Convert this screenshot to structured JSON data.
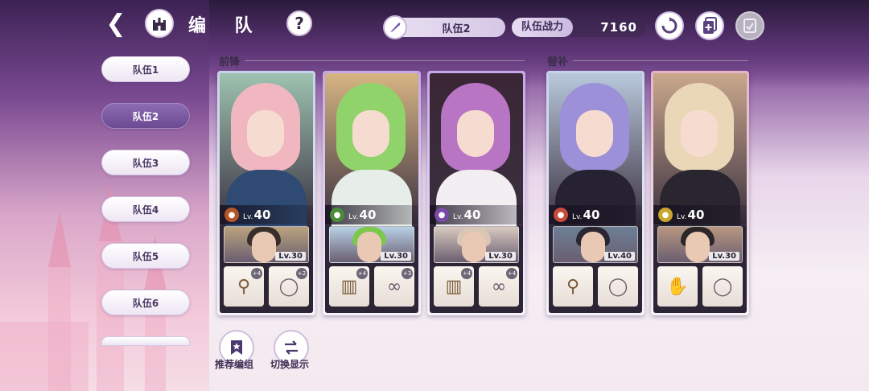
{
  "header": {
    "title": "编 队",
    "current_team": "队伍2",
    "power_label": "队伍战力",
    "power_value": "7160"
  },
  "team_tabs": [
    "队伍1",
    "队伍2",
    "队伍3",
    "队伍4",
    "队伍5",
    "队伍6"
  ],
  "active_team_index": 1,
  "sections": {
    "front": "前锋",
    "sub": "替补"
  },
  "cards": [
    {
      "lv_prefix": "Lv.",
      "level": "40",
      "sub_level": "Lv.30",
      "element_color": "#b5552a",
      "hair_color": "#f0b7c1",
      "outfit_color": "#2f4b73",
      "bg_color": "#9dc3b0",
      "frame_color": "#c7d2ea",
      "sub_hair": "#3a2e2a",
      "sub_bg": "#b9a37e",
      "equip1": {
        "icon": "staff-icon",
        "glyph": "⚲",
        "badge": "+4"
      },
      "equip2": {
        "icon": "ring-icon",
        "glyph": "◯",
        "badge": "+2"
      }
    },
    {
      "lv_prefix": "Lv.",
      "level": "40",
      "sub_level": "Lv.30",
      "element_color": "#4b8c3a",
      "hair_color": "#8fd36a",
      "outfit_color": "#e7ede8",
      "bg_color": "#d7b583",
      "frame_color": "#c6a8e8",
      "sub_hair": "#7cc84c",
      "sub_bg": "#b8d0e6",
      "equip1": {
        "icon": "book-icon",
        "glyph": "▥",
        "badge": "+4"
      },
      "equip2": {
        "icon": "earring-icon",
        "glyph": "∞",
        "badge": "+3"
      }
    },
    {
      "lv_prefix": "Lv.",
      "level": "40",
      "sub_level": "Lv.30",
      "element_color": "#7a4aa8",
      "hair_color": "#b875c4",
      "outfit_color": "#f2eef2",
      "bg_color": "#3a2634",
      "frame_color": "#c6a8e8",
      "sub_hair": "#d9c6b4",
      "sub_bg": "#d8c9c0",
      "equip1": {
        "icon": "book-icon",
        "glyph": "▥",
        "badge": "+4"
      },
      "equip2": {
        "icon": "earring-icon",
        "glyph": "∞",
        "badge": "+4"
      }
    },
    {
      "lv_prefix": "Lv.",
      "level": "40",
      "sub_level": "Lv.40",
      "element_color": "#c84a3a",
      "hair_color": "#9c90d8",
      "outfit_color": "#262232",
      "bg_color": "#b9c9dc",
      "frame_color": "#c7d2ea",
      "sub_hair": "#2a2632",
      "sub_bg": "#6d7f95",
      "equip1": {
        "icon": "wand-icon",
        "glyph": "⚲",
        "badge": ""
      },
      "equip2": {
        "icon": "ring-icon",
        "glyph": "◯",
        "badge": ""
      }
    },
    {
      "lv_prefix": "Lv.",
      "level": "40",
      "sub_level": "Lv.30",
      "element_color": "#c9a62e",
      "hair_color": "#ead7b8",
      "outfit_color": "#2a2630",
      "bg_color": "#caa88c",
      "frame_color": "#e6b4c8",
      "sub_hair": "#2c2628",
      "sub_bg": "#b89680",
      "equip1": {
        "icon": "gauntlet-icon",
        "glyph": "✋",
        "badge": ""
      },
      "equip2": {
        "icon": "ring-icon",
        "glyph": "◯",
        "badge": ""
      }
    }
  ],
  "bottom_buttons": {
    "recommend": "推荐编组",
    "switch_display": "切换显示"
  }
}
